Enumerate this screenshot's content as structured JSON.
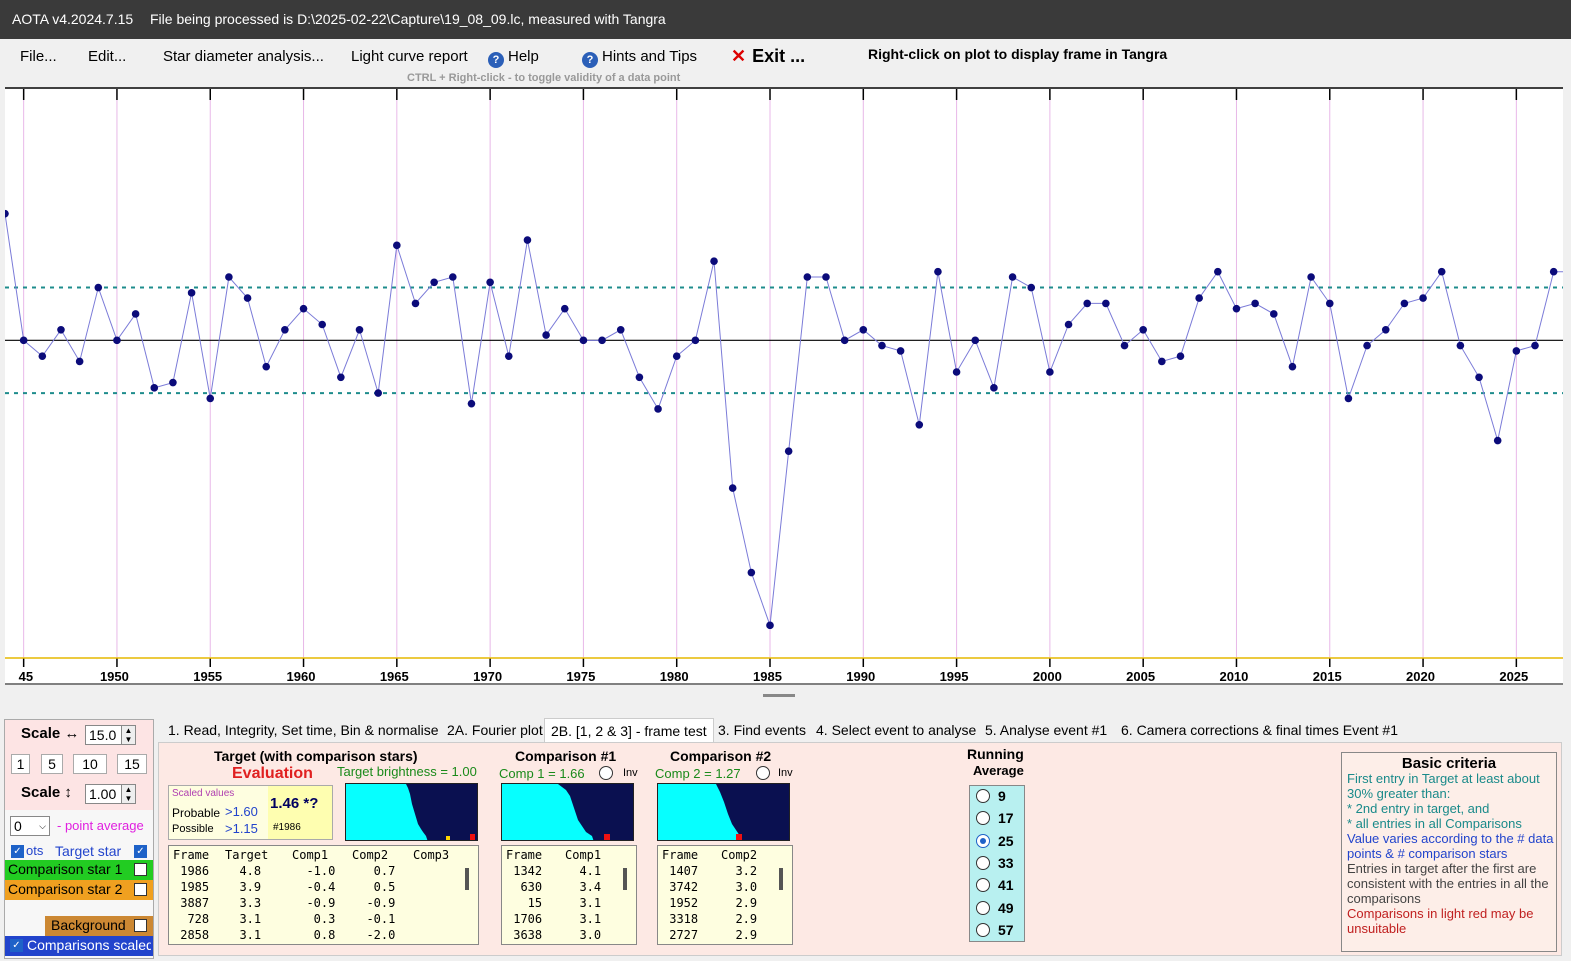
{
  "window": {
    "app_version": "AOTA v4.2024.7.15",
    "file_info": "File being processed is D:\\2025-02-22\\Capture\\19_08_09.lc, measured with Tangra"
  },
  "menu": {
    "file": "File...",
    "edit": "Edit...",
    "star_diameter": "Star diameter analysis...",
    "light_curve_report": "Light curve report",
    "help": "Help",
    "hints": "Hints and Tips",
    "exit": "Exit ...",
    "right_click_hint": "Right-click on plot to display frame in Tangra",
    "ctrl_hint": "CTRL + Right-click  -  to toggle validity of a data point"
  },
  "colors": {
    "series": "#0b0b7a",
    "line": "#7b7bd8",
    "band": "#1e8c8c",
    "grid": "#e8b8e8",
    "axis_bottom": "#e6b800"
  },
  "chart_data": {
    "type": "line",
    "x": [
      1944,
      1945,
      1946,
      1947,
      1948,
      1949,
      1950,
      1951,
      1952,
      1953,
      1954,
      1955,
      1956,
      1957,
      1958,
      1959,
      1960,
      1961,
      1962,
      1963,
      1964,
      1965,
      1966,
      1967,
      1968,
      1969,
      1970,
      1971,
      1972,
      1973,
      1974,
      1975,
      1976,
      1977,
      1978,
      1979,
      1980,
      1981,
      1982,
      1983,
      1984,
      1985,
      1986,
      1987,
      1988,
      1989,
      1990,
      1991,
      1992,
      1993,
      1994,
      1995,
      1996,
      1997,
      1998,
      1999,
      2000,
      2001,
      2002,
      2003,
      2004,
      2005,
      2006,
      2007,
      2008,
      2009,
      2010,
      2011,
      2012,
      2013,
      2014,
      2015,
      2016,
      2017,
      2018,
      2019,
      2020,
      2021,
      2022,
      2023,
      2024,
      2025,
      2026,
      2027,
      2028
    ],
    "values": [
      1.24,
      1.0,
      0.97,
      1.02,
      0.96,
      1.1,
      1.0,
      1.05,
      0.91,
      0.92,
      1.09,
      0.89,
      1.12,
      1.08,
      0.95,
      1.02,
      1.06,
      1.03,
      0.93,
      1.02,
      0.9,
      1.18,
      1.07,
      1.11,
      1.12,
      0.88,
      1.11,
      0.97,
      1.19,
      1.01,
      1.06,
      1.0,
      1.0,
      1.02,
      0.93,
      0.87,
      0.97,
      1.0,
      1.15,
      0.72,
      0.56,
      0.46,
      0.79,
      1.12,
      1.12,
      1.0,
      1.02,
      0.99,
      0.98,
      0.84,
      1.13,
      0.94,
      1.0,
      0.91,
      1.12,
      1.1,
      0.94,
      1.03,
      1.07,
      1.07,
      0.99,
      1.02,
      0.96,
      0.97,
      1.08,
      1.13,
      1.06,
      1.07,
      1.05,
      0.95,
      1.12,
      1.07,
      0.89,
      0.99,
      1.02,
      1.07,
      1.08,
      1.13,
      0.99,
      0.93,
      0.81,
      0.98,
      0.99,
      1.13,
      1.13
    ],
    "baseline": 1.0,
    "band_upper": 1.1,
    "band_lower": 0.9,
    "ylim": [
      0.4,
      1.48
    ],
    "xlim": [
      1944,
      2027.5
    ],
    "tick_labels": [
      "45",
      "1950",
      "1955",
      "1960",
      "1965",
      "1970",
      "1975",
      "1980",
      "1985",
      "1990",
      "1995",
      "2000",
      "2005",
      "2010",
      "2015",
      "2020",
      "2025"
    ],
    "tick_values": [
      1945,
      1950,
      1955,
      1960,
      1965,
      1970,
      1975,
      1980,
      1985,
      1990,
      1995,
      2000,
      2005,
      2010,
      2015,
      2020,
      2025
    ]
  },
  "left_panel": {
    "scale_h_label": "Scale ↔",
    "scale_h_value": "15.0",
    "quick_buttons": [
      "1",
      "5",
      "10",
      "15"
    ],
    "scale_v_label": "Scale ↕",
    "scale_v_value": "1.00",
    "point_avg_value": "0",
    "point_avg_label": "- point average",
    "dots_label": "ots",
    "target_star": "Target star",
    "comp1": "Comparison star 1",
    "comp2": "Comparison star 2",
    "background": "Background",
    "comparisons_scaled": "Comparisons scaled",
    "target_color": "#ffffff",
    "comp1_color": "#22cc22",
    "comp2_color": "#f0a020",
    "background_color": "#cc8833",
    "scaled_color": "#2244cc"
  },
  "tabs": [
    "1.  Read, Integrity, Set time, Bin & normalise",
    "2A. Fourier plot",
    "2B. [1, 2 & 3] - frame test",
    "3. Find events",
    "4. Select event to analyse",
    "5. Analyse event #1",
    "6. Camera corrections & final times Event #1"
  ],
  "target_panel": {
    "title": "Target (with comparison stars)",
    "evaluation": "Evaluation",
    "brightness": "Target  brightness = 1.00",
    "scaled_values": "Scaled values",
    "probable": "Probable",
    "probable_val": ">1.60",
    "possible": "Possible",
    "possible_val": ">1.15",
    "result": "1.46 *?",
    "frame_ref": "#1986",
    "columns": [
      "Frame",
      "Target",
      "Comp1",
      "Comp2",
      "Comp3"
    ],
    "rows": [
      [
        " 1986",
        "  4.8",
        "  -1.0",
        "   0.7",
        ""
      ],
      [
        " 1985",
        "  3.9",
        "  -0.4",
        "   0.5",
        ""
      ],
      [
        " 3887",
        "  3.3",
        "  -0.9",
        "  -0.9",
        ""
      ],
      [
        "  728",
        "  3.1",
        "   0.3",
        "  -0.1",
        ""
      ],
      [
        " 2858",
        "  3.1",
        "   0.8",
        "  -2.0",
        ""
      ]
    ]
  },
  "comp1_panel": {
    "title": "Comparison #1",
    "value": "Comp 1 = 1.66",
    "inv": "Inv",
    "columns": [
      "Frame",
      "Comp1"
    ],
    "rows": [
      [
        " 1342",
        "  4.1"
      ],
      [
        "  630",
        "  3.4"
      ],
      [
        "   15",
        "  3.1"
      ],
      [
        " 1706",
        "  3.1"
      ],
      [
        " 3638",
        "  3.0"
      ]
    ]
  },
  "comp2_panel": {
    "title": "Comparison #2",
    "value": "Comp 2 = 1.27",
    "inv": "Inv",
    "columns": [
      "Frame",
      "Comp2"
    ],
    "rows": [
      [
        " 1407",
        "  3.2"
      ],
      [
        " 3742",
        "  3.0"
      ],
      [
        " 1952",
        "  2.9"
      ],
      [
        " 3318",
        "  2.9"
      ],
      [
        " 2727",
        "  2.9"
      ]
    ]
  },
  "running_average": {
    "title_line1": "Running",
    "title_line2": "Average",
    "options": [
      "9",
      "17",
      "25",
      "33",
      "41",
      "49",
      "57"
    ],
    "selected": "25"
  },
  "criteria": {
    "title": "Basic criteria",
    "line1": "First entry in Target at least about 30% greater than:",
    "line2": "*  2nd  entry in target, and",
    "line3": "*  all entries in all Comparisons",
    "line4": "Value varies according to the # data points & # comparison stars",
    "line5": "Entries in target after the first are consistent with the entries in all the comparisons",
    "line6": "Comparisons in light red may be unsuitable"
  }
}
